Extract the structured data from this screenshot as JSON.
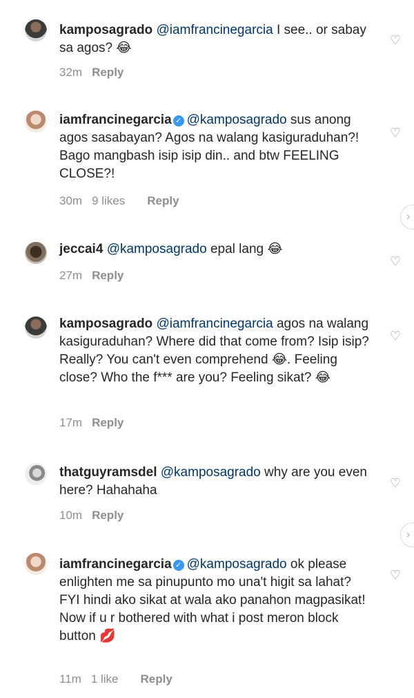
{
  "comments": [
    {
      "username": "kamposagrado",
      "mention": "@iamfrancinegarcia",
      "text": " I see.. or sabay sa agos? 😂",
      "time": "32m",
      "likes": "",
      "reply": "Reply"
    },
    {
      "username": "iamfrancinegarcia",
      "mention": "@kamposagrado",
      "text": " sus anong agos sasabayan? Agos na walang kasiguraduhan?! Bago mangbash isip isip din.. and btw FEELING CLOSE?!",
      "time": "30m",
      "likes": "9 likes",
      "reply": "Reply"
    },
    {
      "username": "jeccai4",
      "mention": "@kamposagrado",
      "text": " epal lang 😂",
      "time": "27m",
      "likes": "",
      "reply": "Reply"
    },
    {
      "username": "kamposagrado",
      "mention": "@iamfrancinegarcia",
      "text": " agos na walang kasiguraduhan? Where did that come from? Isip isip? Really? You can't even comprehend 😂. Feeling close? Who the f*** are you? Feeling sikat? 😂",
      "time": "17m",
      "likes": "",
      "reply": "Reply"
    },
    {
      "username": "thatguyramsdel",
      "mention": "@kamposagrado",
      "text": " why are you even here? Hahahaha",
      "time": "10m",
      "likes": "",
      "reply": "Reply"
    },
    {
      "username": "iamfrancinegarcia",
      "mention": "@kamposagrado",
      "text": " ok please enlighten me sa pinupunto mo una't higit sa lahat? FYI hindi ako sikat at wala ako panahon magpasikat! Now if u r bothered with what i post meron block button 💋",
      "time": "11m",
      "likes": "1 like",
      "reply": "Reply"
    }
  ],
  "icons": {
    "heart": "heart-outline-icon",
    "verified": "verified-badge-icon",
    "more": "chevron-right-icon"
  },
  "colors": {
    "mention": "#00376b",
    "meta": "#8e8e8e",
    "verified": "#3897f0"
  }
}
